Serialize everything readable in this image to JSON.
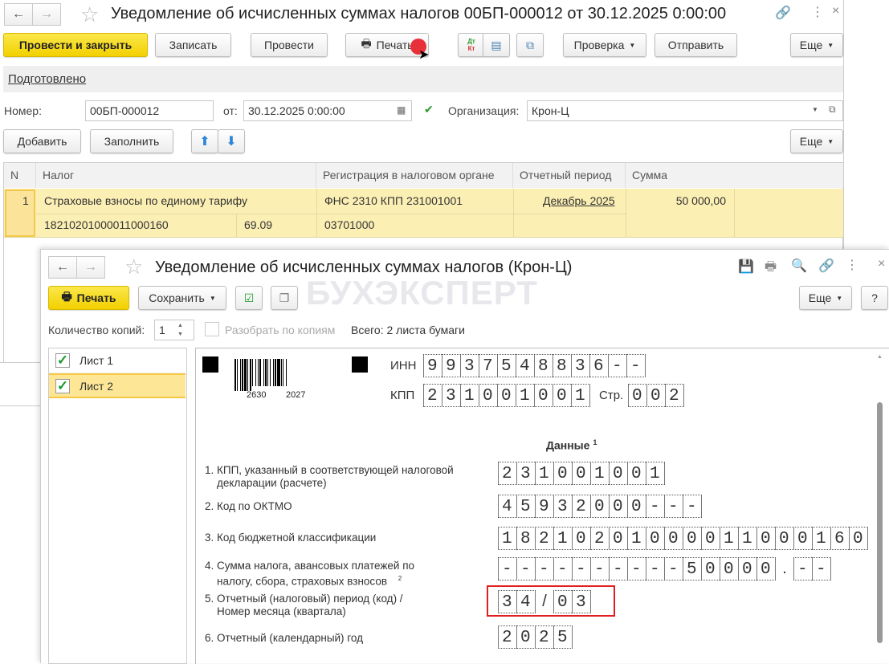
{
  "window1": {
    "title": "Уведомление об исчисленных суммах налогов 00БП-000012 от 30.12.2025 0:00:00",
    "toolbar": {
      "post_close": "Провести и закрыть",
      "save": "Записать",
      "post": "Провести",
      "print": "Печать",
      "dtkt_dt": "Дт",
      "dtkt_kt": "Кт",
      "check": "Проверка",
      "send": "Отправить",
      "more": "Еще"
    },
    "status": "Подготовлено",
    "number_label": "Номер:",
    "number": "00БП-000012",
    "date_label": "от:",
    "date": "30.12.2025  0:00:00",
    "org_label": "Организация:",
    "org": "Крон-Ц",
    "table_toolbar": {
      "add": "Добавить",
      "fill": "Заполнить",
      "more": "Еще"
    },
    "table": {
      "headers": [
        "N",
        "Налог",
        "Регистрация в налоговом органе",
        "Отчетный период",
        "Сумма"
      ],
      "rows": [
        {
          "n": "1",
          "tax": "Страховые взносы по единому тарифу",
          "kbk": "18210201000011000160",
          "code": "69.09",
          "registration": "ФНС 2310 КПП 231001001",
          "oktmo": "03701000",
          "period": "Декабрь 2025",
          "sum": "50 000,00"
        }
      ]
    }
  },
  "window2": {
    "title": "Уведомление об исчисленных суммах налогов (Крон-Ц)",
    "toolbar": {
      "print": "Печать",
      "save": "Сохранить",
      "more": "Еще",
      "help": "?"
    },
    "watermark": "БУХЭКСПЕРТ",
    "copies_label": "Количество копий:",
    "copies": "1",
    "collate": "Разобрать по копиям",
    "total": "Всего: 2 листа бумаги",
    "sheets": [
      {
        "label": "Лист 1",
        "checked": true
      },
      {
        "label": "Лист 2",
        "checked": true
      }
    ],
    "form": {
      "barcode_left": "2630",
      "barcode_right": "2027",
      "inn_label": "ИНН",
      "inn": "9937548836--",
      "kpp_label": "КПП",
      "kpp": "231001001",
      "page_label": "Стр.",
      "page": "002",
      "data_heading": "Данные",
      "data_heading_note": "1",
      "rows": [
        {
          "label": "1. КПП, указанный в соответствующей налоговой",
          "label2": "декларации (расчете)",
          "value": "231001001"
        },
        {
          "label": "2. Код по ОКТМО",
          "label2": "",
          "value": "45932000---"
        },
        {
          "label": "3. Код бюджетной классификации",
          "label2": "",
          "value": "18210201000011000160"
        },
        {
          "label": "4. Сумма налога, авансовых платежей по",
          "label2": "налогу, сбора, страховых взносов",
          "note": "2",
          "value": "----------50000",
          "value_sep": ".",
          "value2": "--"
        },
        {
          "label": "5. Отчетный (налоговый) период (код) /",
          "label2": "Номер месяца (квартала)",
          "value": "34",
          "value_sep": "/",
          "value2": "03"
        },
        {
          "label": "6. Отчетный (календарный) год",
          "label2": "",
          "value": "2025"
        }
      ]
    }
  },
  "colors": {
    "accent_yellow": "#f2d000",
    "selection": "#fcefb4",
    "highlight_border": "#e02020"
  }
}
